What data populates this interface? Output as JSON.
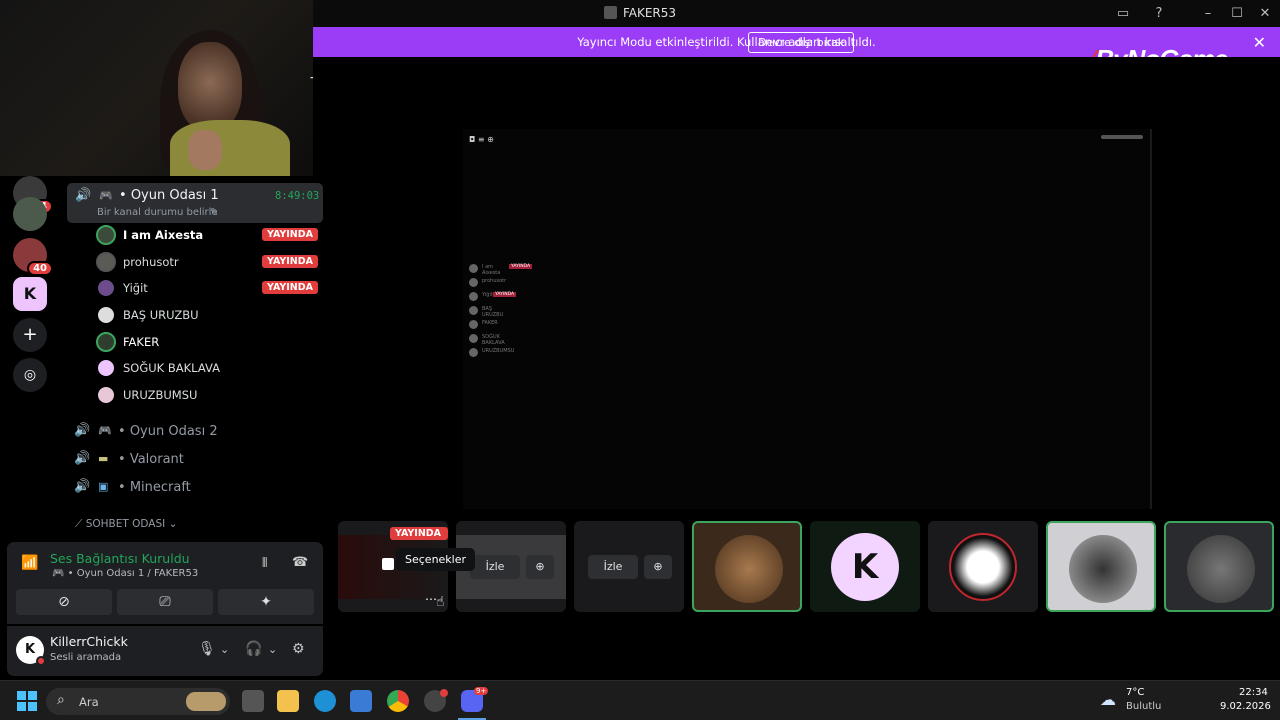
{
  "window": {
    "title": "FAKER53"
  },
  "banner": {
    "message": "Yayıncı Modu etkinleştirildi. Kullanıcı adları kısaltıldı.",
    "disable_label": "Devre dışı bırak",
    "color": "#9b3cf6"
  },
  "watermark": {
    "text": "ByNoGame"
  },
  "guilds": {
    "badges": [
      "4",
      "40"
    ]
  },
  "channels": {
    "active": {
      "name": "Oyun Odası 1",
      "timer": "8:49:03",
      "status_hint": "Bir kanal durumu belirle"
    },
    "members": [
      {
        "name": "I am Aixesta",
        "live": "YAYINDA"
      },
      {
        "name": "prohusotr",
        "live": "YAYINDA"
      },
      {
        "name": "Yiğit",
        "live": "YAYINDA"
      },
      {
        "name": "BAŞ URUZBU",
        "live": ""
      },
      {
        "name": "FAKER",
        "live": ""
      },
      {
        "name": "SOĞUK BAKLAVA",
        "live": ""
      },
      {
        "name": "URUZBUMSU",
        "live": ""
      }
    ],
    "others": [
      {
        "name": "Oyun Odası 2"
      },
      {
        "name": "Valorant"
      },
      {
        "name": "Minecraft"
      }
    ],
    "chat_category": "SOHBET ODASI"
  },
  "voice": {
    "title": "Ses Bağlantısı Kuruldu",
    "sub": "Oyun Odası 1 / FAKER53"
  },
  "user": {
    "name": "KillerrChickk",
    "status": "Sesli aramada",
    "avatar_letter": "K"
  },
  "stream_tiles": {
    "live_badge": "YAYINDA",
    "watch_label": "İzle",
    "tooltip": "Seçenekler"
  },
  "mini_list": [
    "I am Aixesta",
    "prohusotr",
    "Yiğit",
    "BAŞ URUZBU",
    "FAKER",
    "SOĞUK BAKLAVA",
    "URUZBUMSU"
  ],
  "taskbar": {
    "search_placeholder": "Ara",
    "weather_temp": "7°C",
    "weather_desc": "Bulutlu",
    "time": "22:34",
    "date": "9.02.2026",
    "discord_badge": "9+"
  }
}
